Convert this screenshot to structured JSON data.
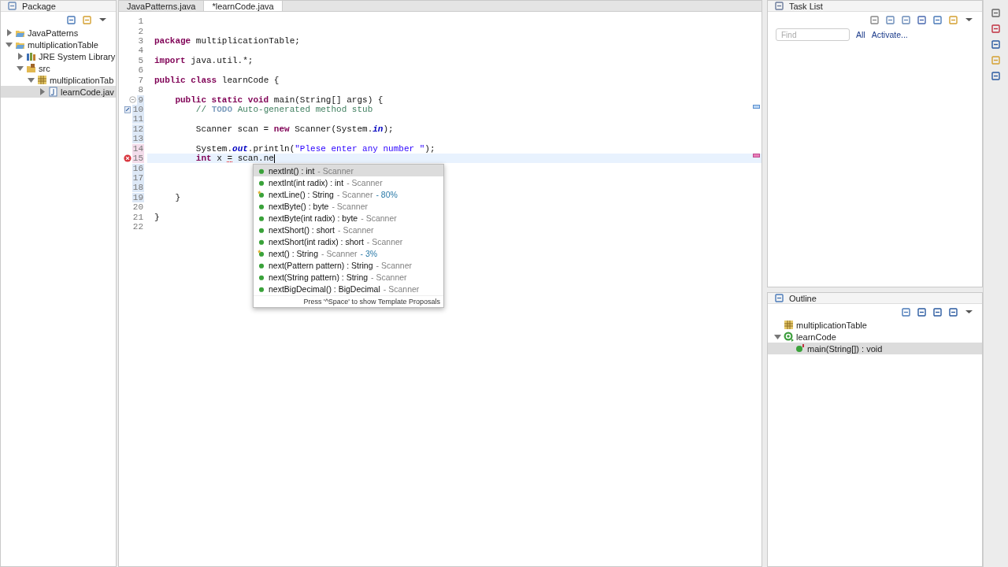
{
  "package_explorer": {
    "title": "Package",
    "tree": [
      {
        "label": "JavaPatterns",
        "kind": "project",
        "expanded": false,
        "selected": false
      },
      {
        "label": "multiplicationTable",
        "kind": "project",
        "expanded": true,
        "selected": false,
        "children": [
          {
            "label": "JRE System Library",
            "kind": "library",
            "expanded": false,
            "selected": false
          },
          {
            "label": "src",
            "kind": "srcfolder",
            "expanded": true,
            "selected": false,
            "children": [
              {
                "label": "multiplicationTab",
                "kind": "package",
                "expanded": true,
                "selected": false,
                "children": [
                  {
                    "label": "learnCode.jav",
                    "kind": "javafile",
                    "expanded": false,
                    "selected": true
                  }
                ]
              }
            ]
          }
        ]
      }
    ]
  },
  "editor": {
    "tabs": [
      {
        "label": "JavaPatterns.java",
        "selected": false
      },
      {
        "label": "*learnCode.java",
        "selected": true
      }
    ],
    "lines": [
      {
        "number": "1"
      },
      {
        "number": "2"
      },
      {
        "number": "3",
        "tokens": [
          {
            "kind": "keyword",
            "text": "package"
          },
          {
            "kind": "plain",
            "text": " multiplicationTable;"
          }
        ]
      },
      {
        "number": "4"
      },
      {
        "number": "5",
        "tokens": [
          {
            "kind": "keyword",
            "text": "import"
          },
          {
            "kind": "plain",
            "text": " java.util.*;"
          }
        ]
      },
      {
        "number": "6"
      },
      {
        "number": "7",
        "tokens": [
          {
            "kind": "keyword",
            "text": "public class"
          },
          {
            "kind": "plain",
            "text": " learnCode {"
          }
        ]
      },
      {
        "number": "8"
      },
      {
        "number": "9",
        "foldable": true,
        "changed": true,
        "tokens": [
          {
            "kind": "keyword",
            "text": "    public static void"
          },
          {
            "kind": "plain",
            "text": " main(String[] args) {"
          }
        ]
      },
      {
        "number": "10",
        "task": true,
        "changed": true,
        "tokens": [
          {
            "kind": "comment",
            "text": "        // "
          },
          {
            "kind": "todo",
            "text": "TODO"
          },
          {
            "kind": "comment",
            "text": " Auto-generated method stub"
          }
        ]
      },
      {
        "number": "11",
        "changed": true
      },
      {
        "number": "12",
        "changed": true,
        "tokens": [
          {
            "kind": "plain",
            "text": "        Scanner scan = "
          },
          {
            "kind": "keyword",
            "text": "new"
          },
          {
            "kind": "plain",
            "text": " Scanner(System."
          },
          {
            "kind": "field",
            "text": "in"
          },
          {
            "kind": "plain",
            "text": ");"
          }
        ]
      },
      {
        "number": "13",
        "changed": true
      },
      {
        "number": "14",
        "modified": true,
        "tokens": [
          {
            "kind": "plain",
            "text": "        System."
          },
          {
            "kind": "field",
            "text": "out"
          },
          {
            "kind": "plain",
            "text": ".println("
          },
          {
            "kind": "string",
            "text": "\"Plese enter any number \""
          },
          {
            "kind": "plain",
            "text": ");"
          }
        ]
      },
      {
        "number": "15",
        "error": true,
        "modified": true,
        "current": true,
        "caret": true,
        "tokens": [
          {
            "kind": "keyword",
            "text": "        int"
          },
          {
            "kind": "plain",
            "text": " x "
          },
          {
            "kind": "error",
            "text": "="
          },
          {
            "kind": "plain",
            "text": " scan.ne"
          }
        ]
      },
      {
        "number": "16",
        "changed": true
      },
      {
        "number": "17",
        "changed": true
      },
      {
        "number": "18",
        "changed": true
      },
      {
        "number": "19",
        "changed": true,
        "tokens": [
          {
            "kind": "plain",
            "text": "    }"
          }
        ]
      },
      {
        "number": "20"
      },
      {
        "number": "21",
        "tokens": [
          {
            "kind": "plain",
            "text": "}"
          }
        ]
      },
      {
        "number": "22"
      }
    ]
  },
  "completion": {
    "items": [
      {
        "signature": "nextInt() : int",
        "owner": "- Scanner",
        "starred": false,
        "selected": true
      },
      {
        "signature": "nextInt(int radix) : int",
        "owner": "- Scanner",
        "starred": false,
        "selected": false
      },
      {
        "signature": "nextLine() : String",
        "owner": "- Scanner",
        "relevance": "- 80%",
        "starred": true,
        "selected": false
      },
      {
        "signature": "nextByte() : byte",
        "owner": "- Scanner",
        "starred": false,
        "selected": false
      },
      {
        "signature": "nextByte(int radix) : byte",
        "owner": "- Scanner",
        "starred": false,
        "selected": false
      },
      {
        "signature": "nextShort() : short",
        "owner": "- Scanner",
        "starred": false,
        "selected": false
      },
      {
        "signature": "nextShort(int radix) : short",
        "owner": "- Scanner",
        "starred": false,
        "selected": false
      },
      {
        "signature": "next() : String",
        "owner": "- Scanner",
        "relevance": "- 3%",
        "starred": true,
        "selected": false
      },
      {
        "signature": "next(Pattern pattern) : String",
        "owner": "- Scanner",
        "starred": false,
        "selected": false
      },
      {
        "signature": "next(String pattern) : String",
        "owner": "- Scanner",
        "starred": false,
        "selected": false
      },
      {
        "signature": "nextBigDecimal() : BigDecimal",
        "owner": "- Scanner",
        "starred": false,
        "selected": false
      }
    ],
    "footer": "Press '^Space' to show Template Proposals"
  },
  "task_list": {
    "title": "Task List",
    "find": {
      "placeholder": "Find"
    },
    "links": [
      "All",
      "Activate..."
    ]
  },
  "outline": {
    "title": "Outline",
    "tree": [
      {
        "label": "multiplicationTable",
        "kind": "package",
        "selected": false
      },
      {
        "label": "learnCode",
        "kind": "class",
        "expanded": true,
        "selected": false,
        "children": [
          {
            "label": "main(String[]) : void",
            "kind": "method",
            "selected": true
          }
        ]
      }
    ]
  }
}
